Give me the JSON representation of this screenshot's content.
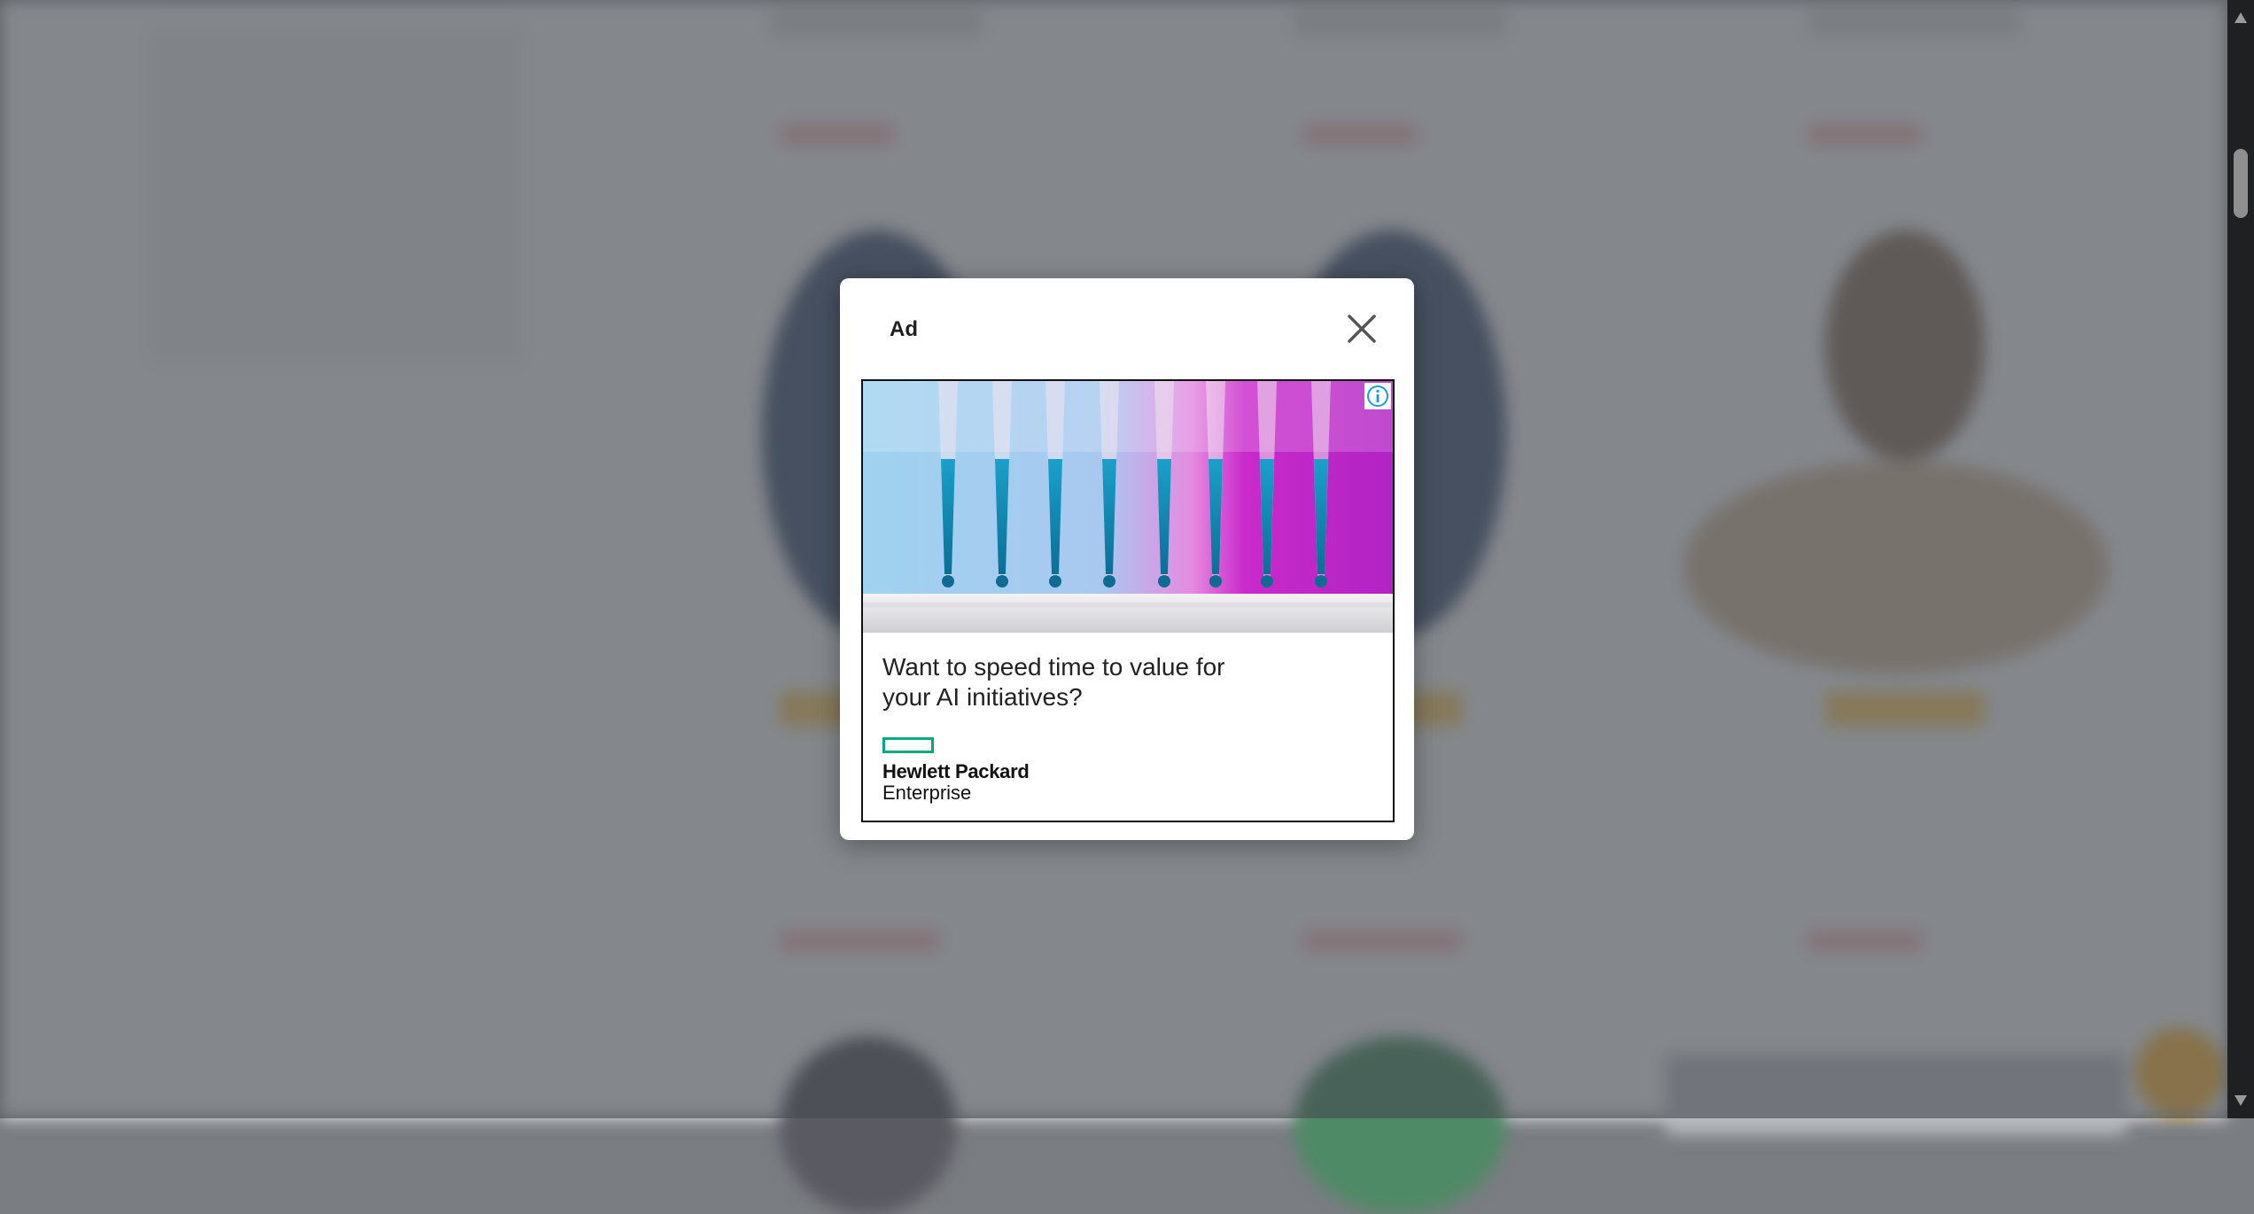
{
  "modal": {
    "title": "Ad",
    "close_icon": "close-icon"
  },
  "ad": {
    "headline": "Want to speed time to value for your AI initiatives?",
    "image": "pipette-tips-image",
    "info_icon": "info-icon",
    "brand": {
      "name_line1": "Hewlett Packard",
      "name_line2": "Enterprise",
      "accent_color": "#01a982"
    }
  },
  "colors": {
    "overlay": "#464a50",
    "modal_bg": "#ffffff",
    "scrollbar": "#1f2022"
  }
}
